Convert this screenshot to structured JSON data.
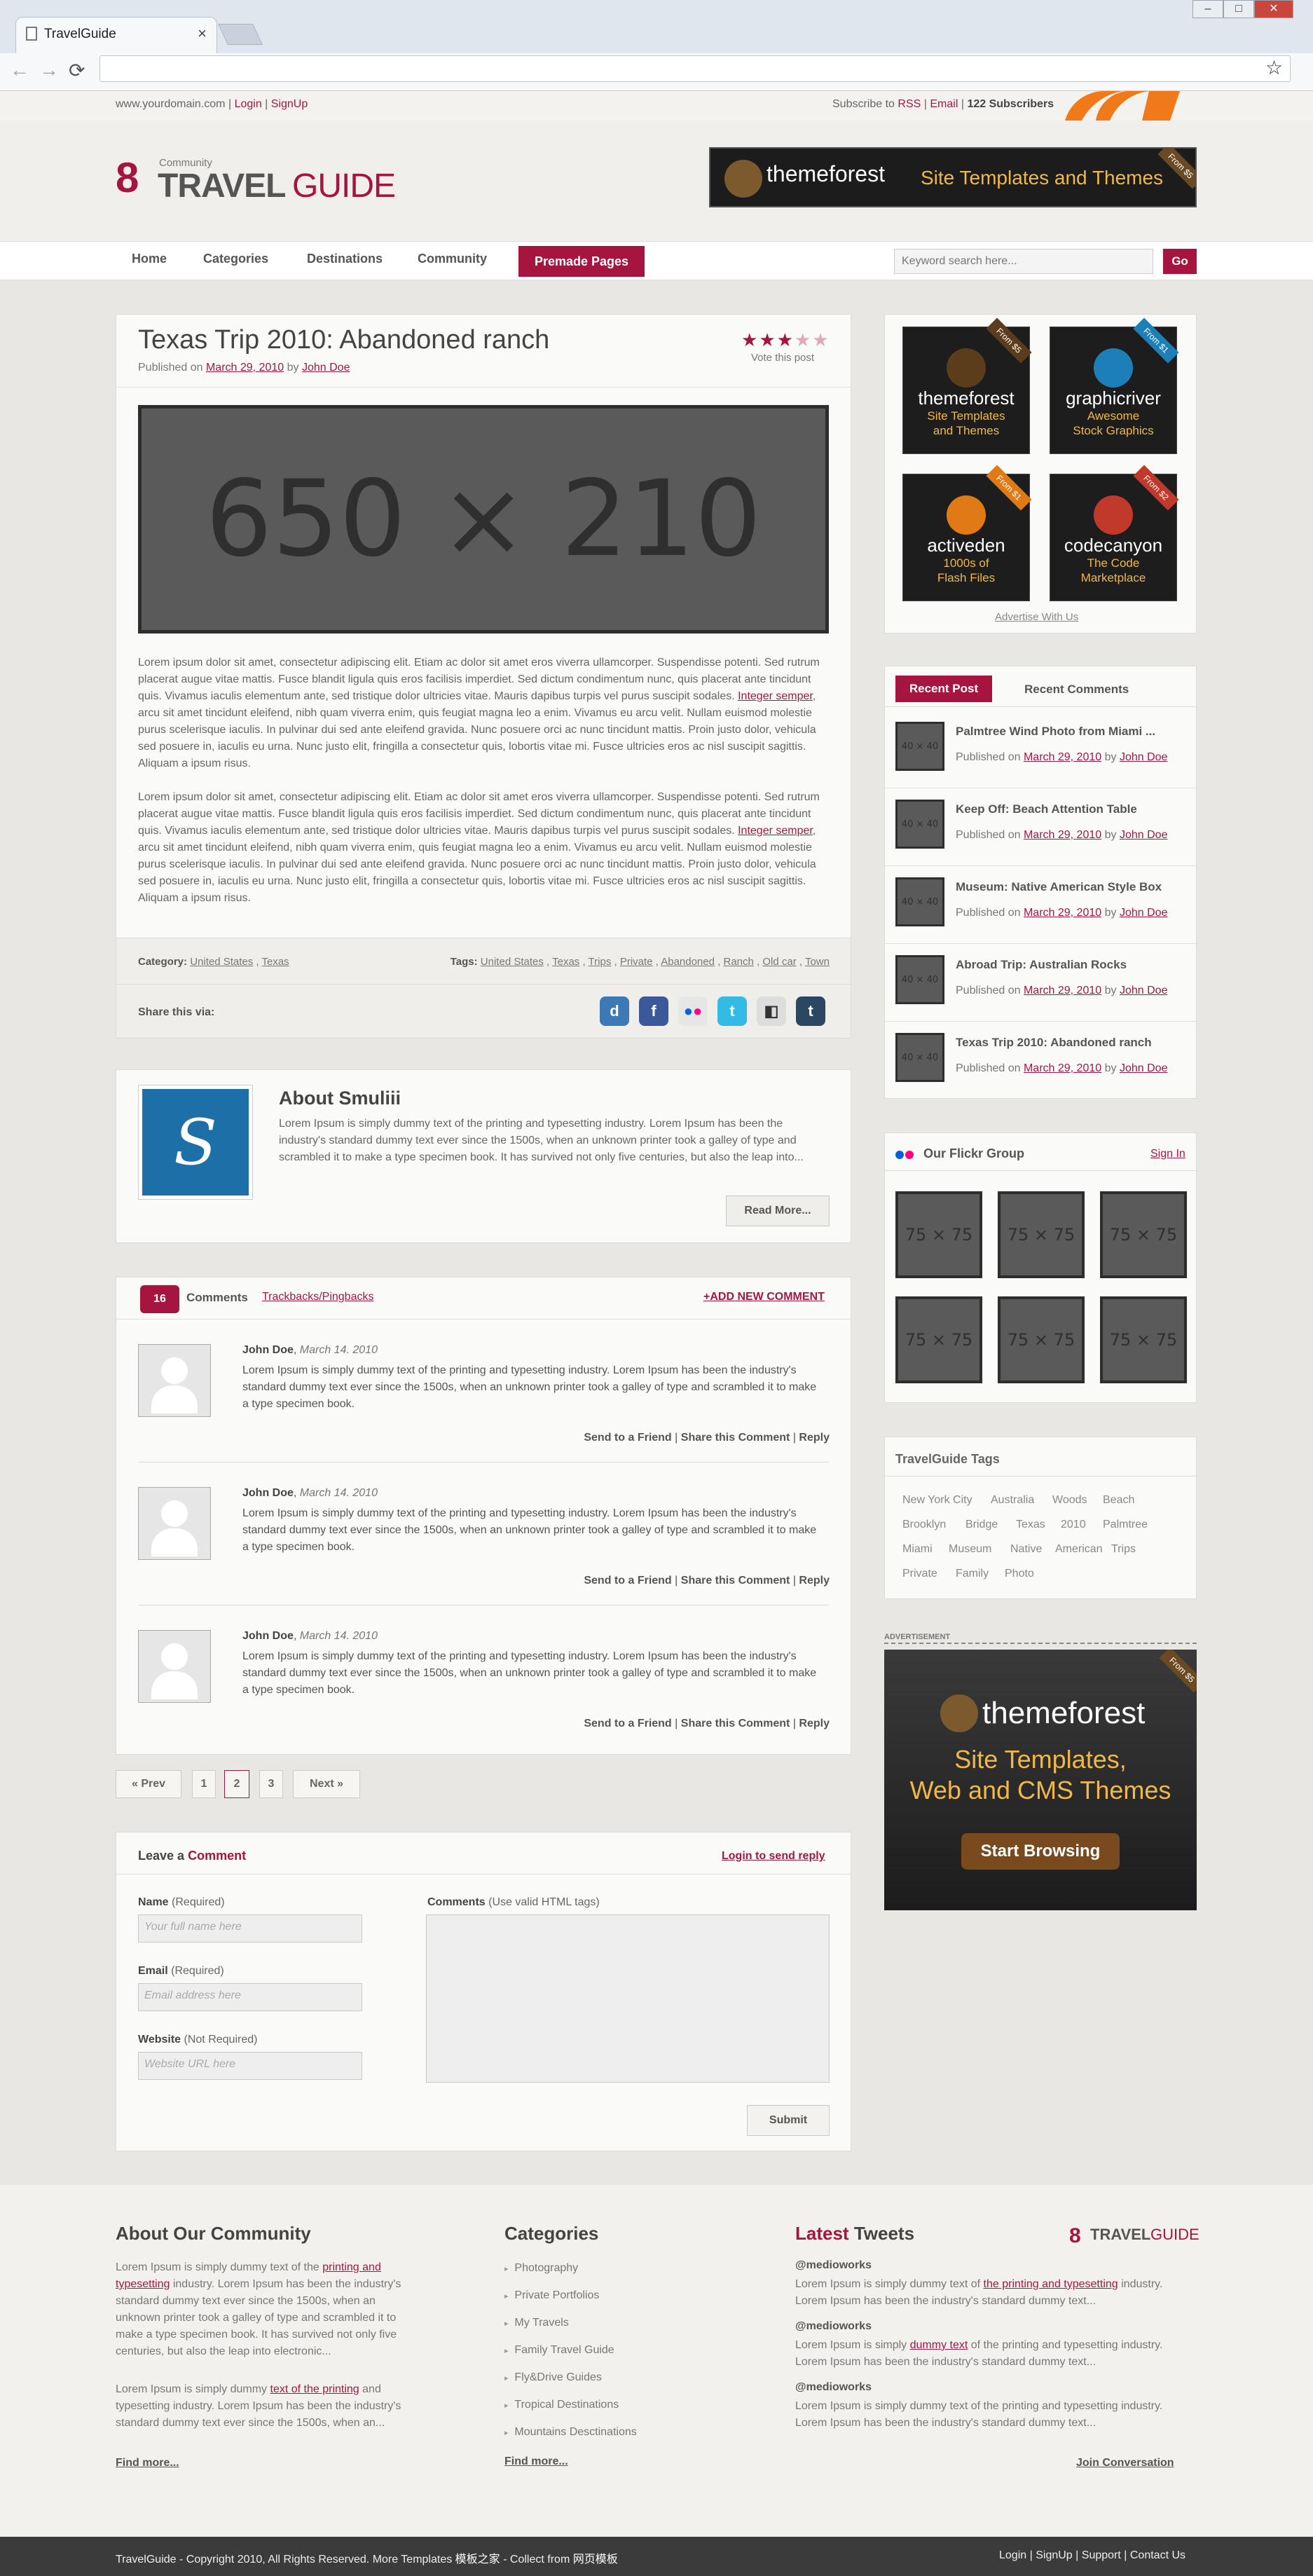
{
  "browser": {
    "tab_title": "TravelGuide",
    "close": "×",
    "nav_back": "←",
    "nav_forward": "→",
    "nav_reload": "⟳",
    "star": "☆"
  },
  "topbar": {
    "domain": "www.yourdomain.com",
    "sep1": "|",
    "login": "Login",
    "sep2": "|",
    "signup": "SignUp",
    "subscribe_prefix": "Subscribe to",
    "rss": "RSS",
    "sep3": "|",
    "email": "Email",
    "sep4": "|",
    "subscribers": "122 Subscribers"
  },
  "logo": {
    "mark": "8",
    "community": "Community",
    "travel": "TRAVEL",
    "guide": "GUIDE"
  },
  "header_ad": {
    "brand": "themeforest",
    "tagline": "Site Templates and Themes",
    "ribbon": "From $5"
  },
  "nav": {
    "items": [
      "Home",
      "Categories",
      "Destinations",
      "Community"
    ],
    "premade": "Premade Pages",
    "search_placeholder": "Keyword search here...",
    "go": "Go"
  },
  "post": {
    "title": "Texas Trip 2010: Abandoned ranch",
    "published_label": "Published on",
    "date": "March 29, 2010",
    "by": "by",
    "author": "John Doe",
    "rating": 3,
    "rating_max": 5,
    "vote": "Vote this post",
    "image_placeholder": "650 × 210",
    "p1a": "Lorem ipsum dolor sit amet, consectetur adipiscing elit. Etiam ac dolor sit amet eros viverra ullamcorper. Suspendisse potenti. Sed rutrum placerat augue vitae mattis. Fusce blandit ligula quis eros facilisis imperdiet. Sed dictum condimentum nunc, quis placerat ante tincidunt quis. Vivamus iaculis elementum ante, sed tristique dolor ultricies vitae. Mauris dapibus turpis vel purus suscipit sodales.",
    "p1link": "Integer semper",
    "p1b": ", arcu sit amet tincidunt eleifend, nibh quam viverra enim, quis feugiat magna leo a enim. Vivamus eu arcu velit. Nullam euismod molestie purus scelerisque iaculis. In pulvinar dui sed ante eleifend gravida. Nunc posuere orci ac nunc tincidunt mattis. Proin justo dolor, vehicula sed posuere in, iaculis eu urna. Nunc justo elit, fringilla a consectetur quis, lobortis vitae mi. Fusce ultricies eros ac nisl suscipit sagittis. Aliquam a ipsum risus.",
    "p2a": "Lorem ipsum dolor sit amet, consectetur adipiscing elit. Etiam ac dolor sit amet eros viverra ullamcorper. Suspendisse potenti. Sed rutrum placerat augue vitae mattis. Fusce blandit ligula quis eros facilisis imperdiet. Sed dictum condimentum nunc, quis placerat ante tincidunt quis. Vivamus iaculis elementum ante, sed tristique dolor ultricies vitae. Mauris dapibus turpis vel purus suscipit sodales.",
    "p2link": "Integer semper",
    "p2b": ", arcu sit amet tincidunt eleifend, nibh quam viverra enim, quis feugiat magna leo a enim. Vivamus eu arcu velit. Nullam euismod molestie purus scelerisque iaculis. In pulvinar dui sed ante eleifend gravida. Nunc posuere orci ac nunc tincidunt mattis. Proin justo dolor, vehicula sed posuere in, iaculis eu urna. Nunc justo elit, fringilla a consectetur quis, lobortis vitae mi. Fusce ultricies eros ac nisl suscipit sagittis. Aliquam a ipsum risus.",
    "category_label": "Category:",
    "categories": [
      "United States",
      "Texas"
    ],
    "tags_label": "Tags:",
    "tags": [
      "United States",
      "Texas",
      "Trips",
      "Private",
      "Abandoned",
      "Ranch",
      "Old car",
      "Town"
    ],
    "share_label": "Share this via:"
  },
  "about": {
    "title": "About Smuliii",
    "text": "Lorem Ipsum is simply dummy text of the printing and typesetting industry. Lorem Ipsum has been the industry's standard dummy text ever since the 1500s, when an unknown printer took a galley of type and scrambled it to make a type specimen book. It has survived not only five centuries, but also the leap into...",
    "read_more": "Read More..."
  },
  "comments": {
    "count": "16",
    "label": "Comments",
    "trackbacks": "Trackbacks/Pingbacks",
    "add": "+ADD NEW COMMENT",
    "items": [
      {
        "name": "John Doe",
        "date": "March 14. 2010",
        "text": "Lorem Ipsum is simply dummy text of the printing and typesetting industry. Lorem Ipsum has been the industry's standard dummy text ever since the 1500s, when an unknown printer took a galley of type and scrambled it to make a type specimen book."
      },
      {
        "name": "John Doe",
        "date": "March 14. 2010",
        "text": "Lorem Ipsum is simply dummy text of the printing and typesetting industry. Lorem Ipsum has been the industry's standard dummy text ever since the 1500s, when an unknown printer took a galley of type and scrambled it to make a type specimen book."
      },
      {
        "name": "John Doe",
        "date": "March 14. 2010",
        "text": "Lorem Ipsum is simply dummy text of the printing and typesetting industry. Lorem Ipsum has been the industry's standard dummy text ever since the 1500s, when an unknown printer took a galley of type and scrambled it to make a type specimen book."
      }
    ],
    "send": "Send to a Friend",
    "share": "Share this Comment",
    "reply": "Reply",
    "sep": "|"
  },
  "pagination": {
    "prev": "« Prev",
    "pages": [
      "1",
      "2",
      "3"
    ],
    "next": "Next »"
  },
  "leave": {
    "title_a": "Leave a",
    "title_b": "Comment",
    "login": "Login to send reply",
    "name_label": "Name",
    "name_req": "(Required)",
    "name_ph": "Your full name here",
    "email_label": "Email",
    "email_req": "(Required)",
    "email_ph": "Email address here",
    "website_label": "Website",
    "website_req": "(Not Required)",
    "website_ph": "Website URL here",
    "comments_label": "Comments",
    "comments_hint": "(Use valid HTML tags)",
    "submit": "Submit"
  },
  "sidebar": {
    "ads": [
      {
        "brand": "themeforest",
        "line1": "Site Templates",
        "line2": "and Themes",
        "ribbon": "From $5",
        "color": "#5b3c1b"
      },
      {
        "brand": "graphicriver",
        "line1": "Awesome",
        "line2": "Stock Graphics",
        "ribbon": "From $1",
        "color": "#1d7fb8"
      },
      {
        "brand": "activeden",
        "line1": "1000s of",
        "line2": "Flash Files",
        "ribbon": "From $1",
        "color": "#e07a15"
      },
      {
        "brand": "codecanyon",
        "line1": "The Code",
        "line2": "Marketplace",
        "ribbon": "From $2",
        "color": "#c0392b"
      }
    ],
    "advertise": "Advertise With Us",
    "tab_recent": "Recent Post",
    "tab_comments": "Recent Comments",
    "thumb": "40 × 40",
    "recent": [
      {
        "title": "Palmtree Wind Photo from Miami ...",
        "date": "March 29, 2010",
        "author": "John Doe"
      },
      {
        "title": "Keep Off: Beach Attention Table",
        "date": "March 29, 2010",
        "author": "John Doe"
      },
      {
        "title": "Museum: Native American Style Box",
        "date": "March 29, 2010",
        "author": "John Doe"
      },
      {
        "title": "Abroad Trip: Australian Rocks",
        "date": "March 29, 2010",
        "author": "John Doe"
      },
      {
        "title": "Texas Trip 2010: Abandoned ranch",
        "date": "March 29, 2010",
        "author": "John Doe"
      }
    ],
    "published": "Published on",
    "by": "by",
    "flickr_title": "Our Flickr Group",
    "flickr_sign": "Sign In",
    "flickr_thumb": "75 × 75",
    "tags_title": "TravelGuide Tags",
    "tags": [
      "New York City",
      "Australia",
      "Woods",
      "Beach",
      "Brooklyn",
      "Bridge",
      "Texas",
      "2010",
      "Palmtree",
      "Miami",
      "Museum",
      "Native",
      "American",
      "Trips",
      "Private",
      "Family",
      "Photo"
    ],
    "ad_label": "ADVERTISEMENT",
    "big_ad": {
      "brand": "themeforest",
      "line1": "Site Templates,",
      "line2": "Web and CMS Themes",
      "cta": "Start Browsing",
      "ribbon": "From $5"
    }
  },
  "footer": {
    "about_title": "About Our Community",
    "about_p1a": "Lorem Ipsum is simply dummy text of the",
    "about_p1link": "printing and typesetting",
    "about_p1b": "industry. Lorem Ipsum has been the industry's standard dummy text ever since the 1500s, when an unknown printer took a galley of type and scrambled it to make a type specimen book. It has survived not only five centuries, but also the leap into electronic...",
    "about_p2a": "Lorem Ipsum is simply dummy",
    "about_p2link": "text of the printing",
    "about_p2b": "and typesetting industry. Lorem Ipsum has been the industry's standard dummy text ever since the 1500s, when an...",
    "find_more": "Find more...",
    "cat_title": "Categories",
    "cats": [
      "Photography",
      "Private Portfolios",
      "My Travels",
      "Family Travel Guide",
      "Fly&Drive Guides",
      "Tropical Destinations",
      "Mountains Desctinations"
    ],
    "cat_find_more": "Find more...",
    "tweets_title_a": "Latest",
    "tweets_title_b": "Tweets",
    "tweets": [
      {
        "handle": "@medioworks",
        "a": "Lorem Ipsum is simply dummy text of",
        "link": "the printing and typesetting",
        "b": "industry. Lorem Ipsum has been the industry's standard dummy text..."
      },
      {
        "handle": "@medioworks",
        "a": "Lorem Ipsum is simply",
        "link": "dummy text",
        "b": "of the printing and typesetting industry. Lorem Ipsum has been the industry's standard dummy text..."
      },
      {
        "handle": "@medioworks",
        "a": "Lorem Ipsum is simply dummy text of the printing and typesetting industry. Lorem Ipsum has been the industry's standard dummy text...",
        "link": "",
        "b": ""
      }
    ],
    "join": "Join Conversation"
  },
  "bottom": {
    "copyright": "TravelGuide - Copyright 2010, All Rights Reserved. More Templates",
    "tpl_link": "模板之家",
    "collect": "- Collect from",
    "collect_link": "网页模板",
    "links": [
      "Login",
      "SignUp",
      "Support",
      "Contact Us"
    ],
    "sep": "|"
  },
  "colors": {
    "accent": "#a5153f",
    "bg": "#e8e7e4",
    "panel": "#fafaf9"
  }
}
